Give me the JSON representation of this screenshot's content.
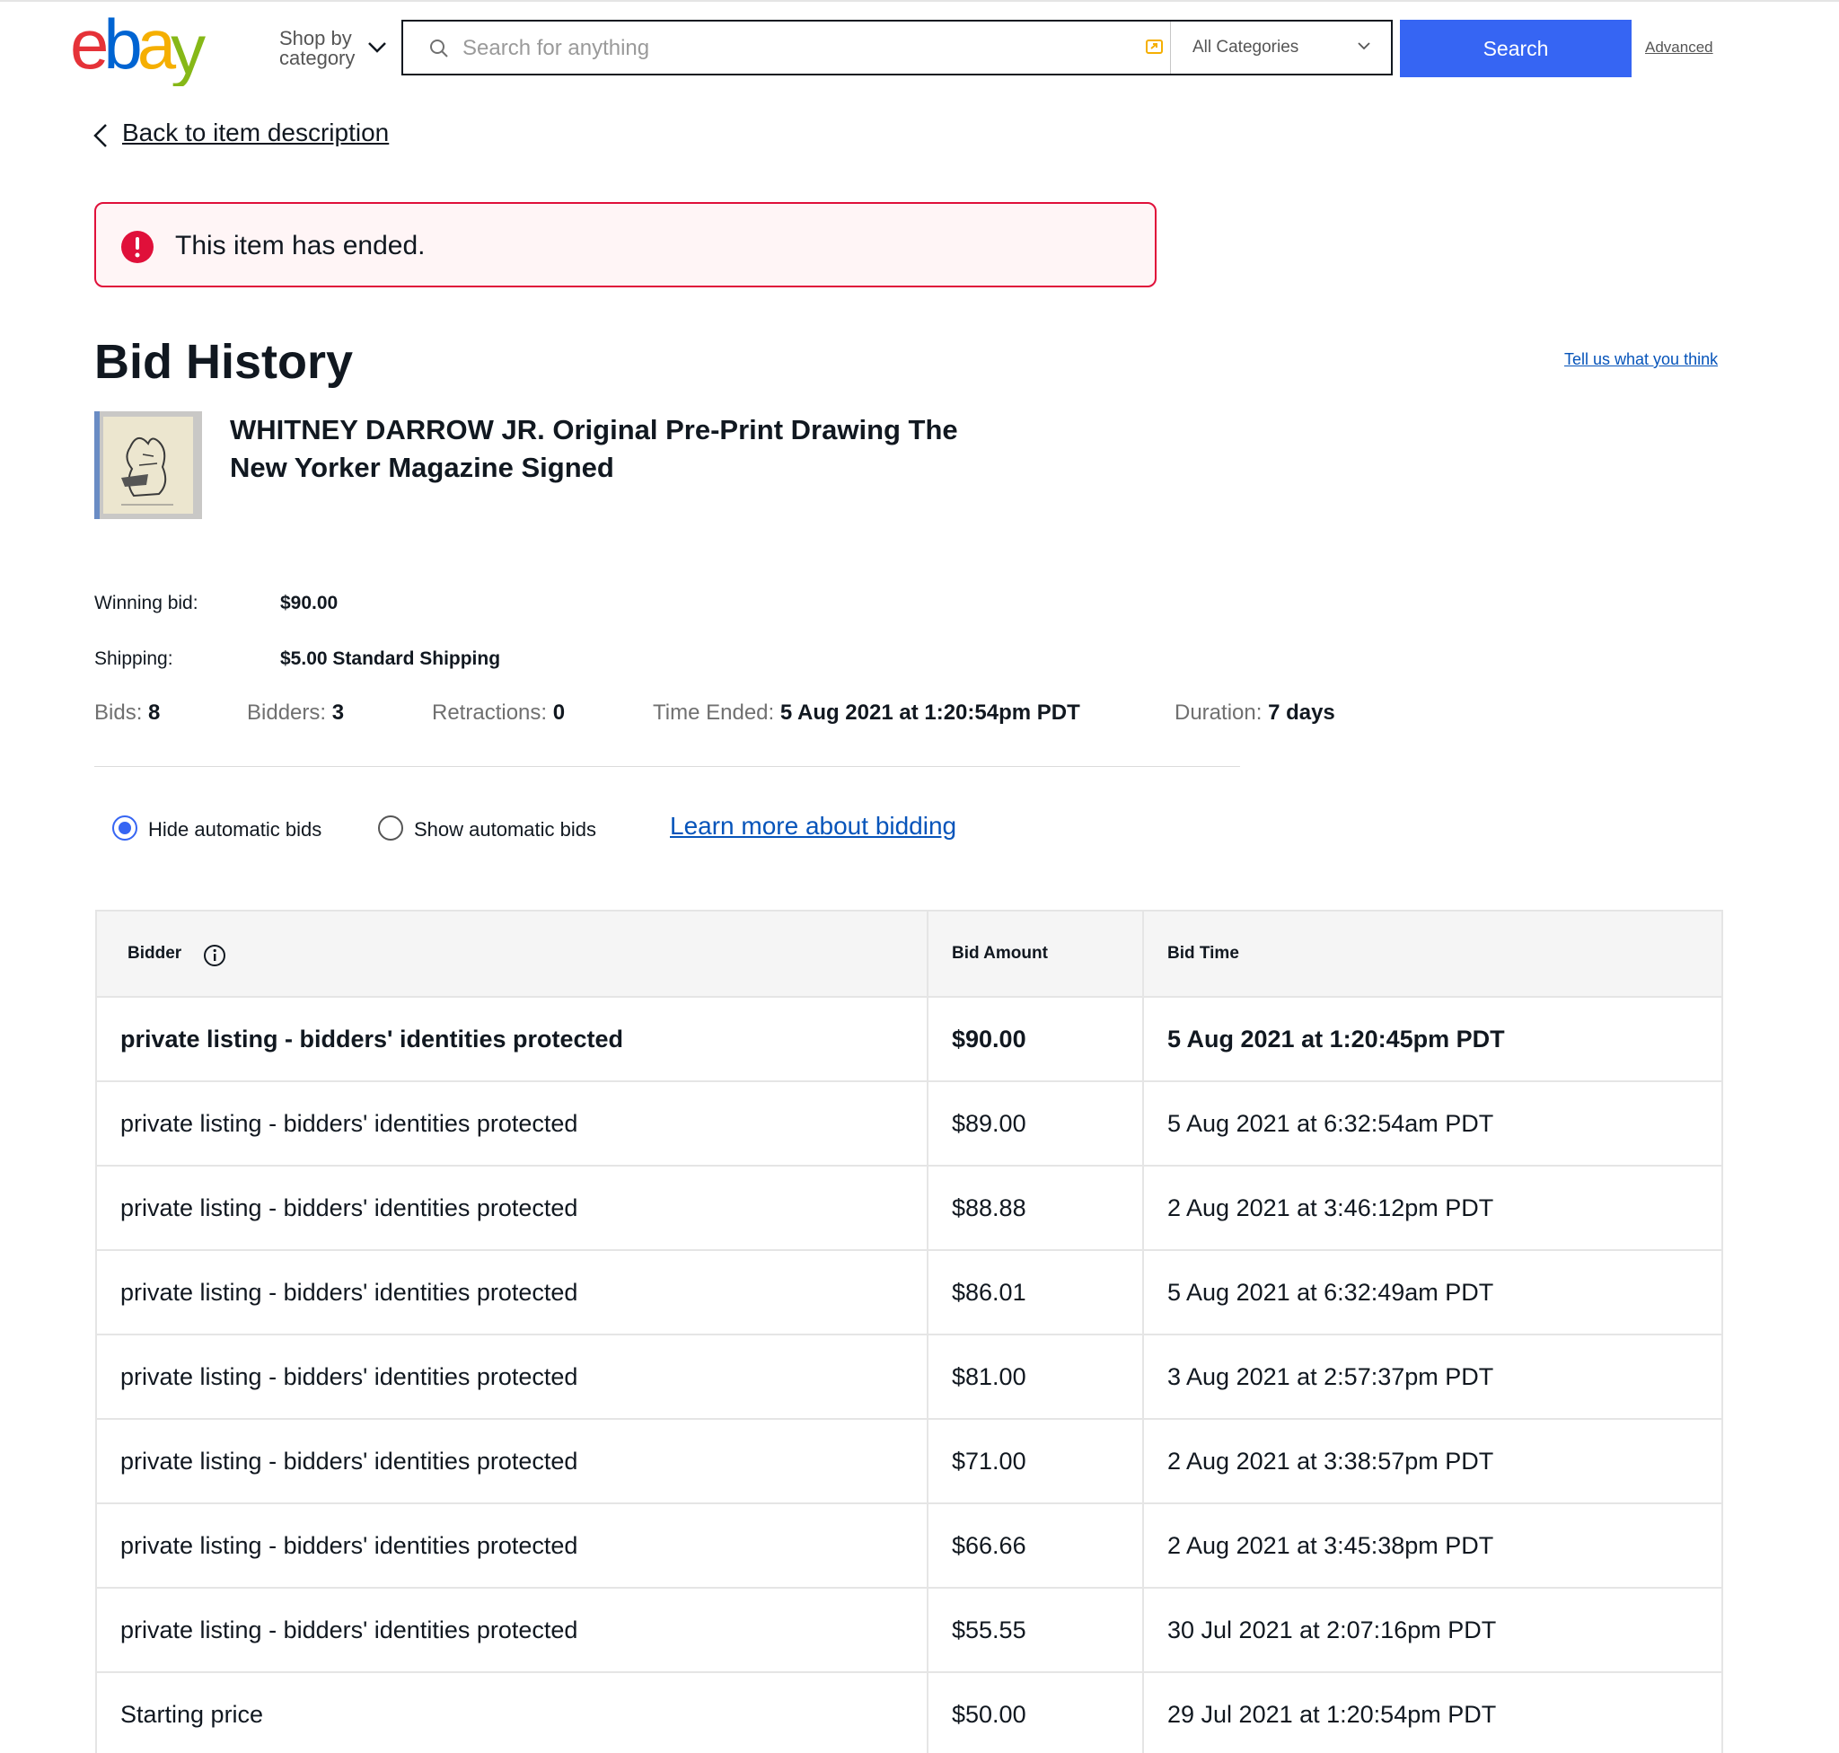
{
  "header": {
    "logo_text": "ebay",
    "shop_by_category_label": "Shop by\ncategory",
    "search_placeholder": "Search for anything",
    "category_selected": "All Categories",
    "search_button_label": "Search",
    "advanced_link": "Advanced",
    "icons": [
      "search-icon",
      "camera-icon",
      "chevron-down-icon"
    ],
    "colors": {
      "logo_e": "#e53238",
      "logo_b": "#0064d2",
      "logo_a": "#f5af02",
      "logo_y": "#86b817",
      "search_button": "#3665f3"
    }
  },
  "nav": {
    "back_link": "Back to item description"
  },
  "alert": {
    "message": "This item has ended.",
    "icon": "exclamation-icon",
    "color": "#e0103a"
  },
  "page": {
    "title": "Bid History",
    "feedback_link": "Tell us what you think"
  },
  "item": {
    "title": "WHITNEY DARROW JR. Original Pre-Print Drawing The New Yorker Magazine Signed"
  },
  "summary": {
    "winning_bid_label": "Winning bid:",
    "winning_bid_value": "$90.00",
    "shipping_label": "Shipping:",
    "shipping_value": "$5.00 Standard Shipping",
    "bids_label": "Bids:",
    "bids_value": "8",
    "bidders_label": "Bidders:",
    "bidders_value": "3",
    "retractions_label": "Retractions:",
    "retractions_value": "0",
    "time_ended_label": "Time Ended:",
    "time_ended_value": "5 Aug 2021 at 1:20:54pm PDT",
    "duration_label": "Duration:",
    "duration_value": "7 days"
  },
  "filters": {
    "hide_label": "Hide automatic bids",
    "show_label": "Show automatic bids",
    "selected": "hide",
    "learn_more_link": "Learn more about bidding"
  },
  "table": {
    "headers": {
      "bidder": "Bidder",
      "amount": "Bid Amount",
      "time": "Bid Time"
    },
    "rows": [
      {
        "bidder": "private listing - bidders' identities protected",
        "amount": "$90.00",
        "time": "5 Aug 2021 at 1:20:45pm PDT"
      },
      {
        "bidder": "private listing - bidders' identities protected",
        "amount": "$89.00",
        "time": "5 Aug 2021 at 6:32:54am PDT"
      },
      {
        "bidder": "private listing - bidders' identities protected",
        "amount": "$88.88",
        "time": "2 Aug 2021 at 3:46:12pm PDT"
      },
      {
        "bidder": "private listing - bidders' identities protected",
        "amount": "$86.01",
        "time": "5 Aug 2021 at 6:32:49am PDT"
      },
      {
        "bidder": "private listing - bidders' identities protected",
        "amount": "$81.00",
        "time": "3 Aug 2021 at 2:57:37pm PDT"
      },
      {
        "bidder": "private listing - bidders' identities protected",
        "amount": "$71.00",
        "time": "2 Aug 2021 at 3:38:57pm PDT"
      },
      {
        "bidder": "private listing - bidders' identities protected",
        "amount": "$66.66",
        "time": "2 Aug 2021 at 3:45:38pm PDT"
      },
      {
        "bidder": "private listing - bidders' identities protected",
        "amount": "$55.55",
        "time": "30 Jul 2021 at 2:07:16pm PDT"
      },
      {
        "bidder": "Starting price",
        "amount": "$50.00",
        "time": "29 Jul 2021 at 1:20:54pm PDT"
      }
    ]
  }
}
